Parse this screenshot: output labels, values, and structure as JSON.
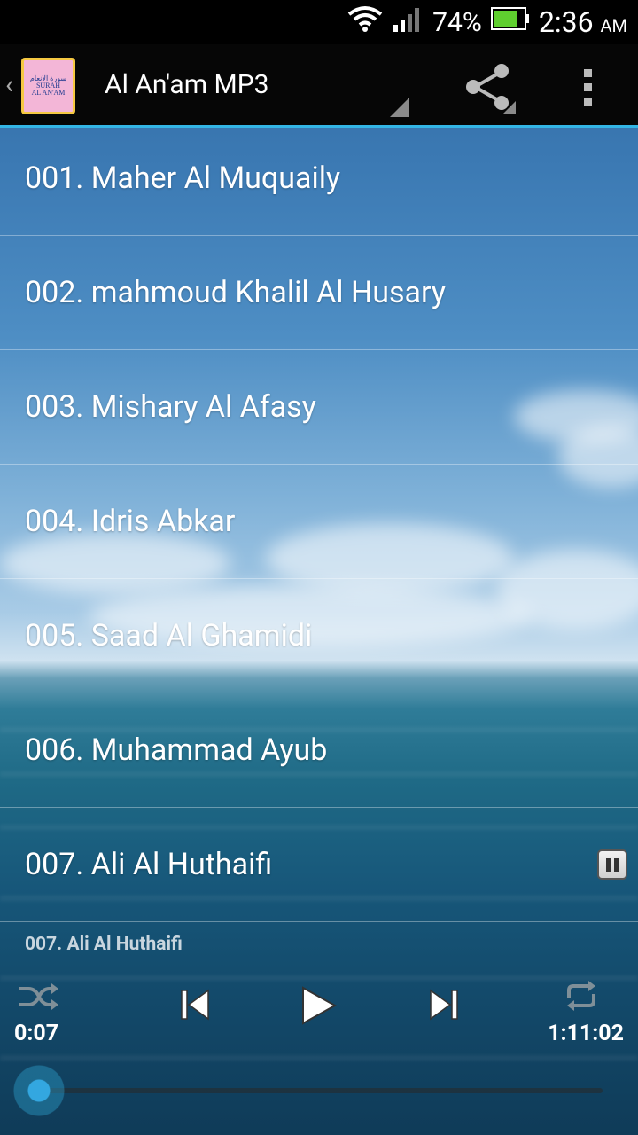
{
  "status_bar": {
    "battery_percent": "74%",
    "time": "2:36",
    "am_pm": "AM"
  },
  "action_bar": {
    "app_icon_text": [
      "سورة الانعام",
      "SURAH",
      "AL AN'AM"
    ],
    "title": "Al An'am MP3"
  },
  "tracks": [
    {
      "label": "001. Maher Al Muquaily"
    },
    {
      "label": "002. mahmoud Khalil Al Husary"
    },
    {
      "label": "003. Mishary Al Afasy"
    },
    {
      "label": "004. Idris Abkar"
    },
    {
      "label": "005. Saad Al Ghamidi"
    },
    {
      "label": "006. Muhammad Ayub"
    },
    {
      "label": "007. Ali Al Huthaifi",
      "playing": true
    }
  ],
  "player": {
    "now_playing": "007. Ali Al Huthaifi",
    "elapsed": "0:07",
    "duration": "1:11:02",
    "progress_fraction": 0.002,
    "accent_color": "#33b5e5"
  }
}
